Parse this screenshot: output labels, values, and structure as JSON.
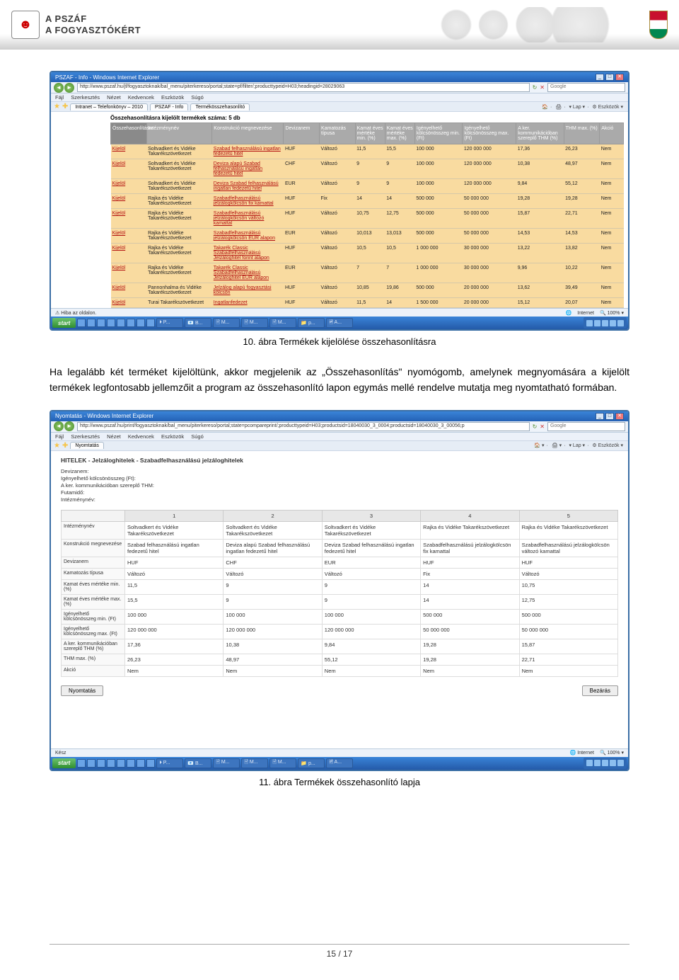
{
  "header": {
    "title1": "A PSZÁF",
    "title2": "A FOGYASZTÓKÉRT"
  },
  "fig1": {
    "window_title": "PSZAF - Info - Windows Internet Explorer",
    "url": "http://www.pszaf.hu/jf/fogyasztoknak/bal_menu/piterkereso/portal;state=pf/filter/;producttypeid=H03;headingid=28029063",
    "search_placeholder": "Google",
    "menu": [
      "Fájl",
      "Szerkesztés",
      "Nézet",
      "Kedvencek",
      "Eszközök",
      "Súgó"
    ],
    "tabs": [
      "Intranet – Telefonkönyv – 2010",
      "PSZAF - Info",
      "Termékösszehasonlító"
    ],
    "toolbar": [
      "🏠",
      "🖨",
      "▾ Lap ▾",
      "⚙ Eszközök ▾"
    ],
    "count_label": "Összehasonlításra kijelölt termékek száma: 5 db",
    "cols": [
      "Összehasonlításra",
      "Intézménynév",
      "Konstrukció megnevezése",
      "Devizanem",
      "Kamatozás típusa",
      "Kamat éves mértéke min. (%)",
      "Kamat éves mértéke max. (%)",
      "Igényelhető kölcsönösszeg min. (Ft)",
      "Igényelhető kölcsönösszeg max. (Ft)",
      "A ker. kommunikációban szereplő THM (%)",
      "THM max. (%)",
      "Akció"
    ],
    "kijelol": "Kijelöl",
    "rows": [
      {
        "inst": "Soltvadkert és Vidéke Takarékszövetkezet",
        "prod": "Szabad felhasználású ingatlan fedezetű hitel",
        "dev": "HUF",
        "kt": "Változó",
        "kmin": "11,5",
        "kmax": "15,5",
        "imin": "100 000",
        "imax": "120 000 000",
        "thm": "17,36",
        "thmmax": "26,23",
        "ak": "Nem"
      },
      {
        "inst": "Soltvadkert és Vidéke Takarékszövetkezet",
        "prod": "Deviza alapú Szabad felhasználású ingatlan fedezetű hitel",
        "dev": "CHF",
        "kt": "Változó",
        "kmin": "9",
        "kmax": "9",
        "imin": "100 000",
        "imax": "120 000 000",
        "thm": "10,38",
        "thmmax": "48,97",
        "ak": "Nem"
      },
      {
        "inst": "Soltvadkert és Vidéke Takarékszövetkezet",
        "prod": "Deviza Szabad felhasználású ingatlan fedezetű hitel",
        "dev": "EUR",
        "kt": "Változó",
        "kmin": "9",
        "kmax": "9",
        "imin": "100 000",
        "imax": "120 000 000",
        "thm": "9,84",
        "thmmax": "55,12",
        "ak": "Nem"
      },
      {
        "inst": "Rajka és Vidéke Takarékszövetkezet",
        "prod": "Szabadfelhasználású jelzálogkölcsön fix kamattal",
        "dev": "HUF",
        "kt": "Fix",
        "kmin": "14",
        "kmax": "14",
        "imin": "500 000",
        "imax": "50 000 000",
        "thm": "19,28",
        "thmmax": "19,28",
        "ak": "Nem"
      },
      {
        "inst": "Rajka és Vidéke Takarékszövetkezet",
        "prod": "Szabadfelhasználású jelzálogkölcsön változó kamattal",
        "dev": "HUF",
        "kt": "Változó",
        "kmin": "10,75",
        "kmax": "12,75",
        "imin": "500 000",
        "imax": "50 000 000",
        "thm": "15,87",
        "thmmax": "22,71",
        "ak": "Nem"
      },
      {
        "inst": "Rajka és Vidéke Takarékszövetkezet",
        "prod": "Szabadfelhasználású jelzálogkölcsön EUR alapon",
        "dev": "EUR",
        "kt": "Változó",
        "kmin": "10,013",
        "kmax": "13,013",
        "imin": "500 000",
        "imax": "50 000 000",
        "thm": "14,53",
        "thmmax": "14,53",
        "ak": "Nem"
      },
      {
        "inst": "Rajka és Vidéke Takarékszövetkezet",
        "prod": "Takarék Classic Szabadfelhasználású Jelzáloghitel forint alapon",
        "dev": "HUF",
        "kt": "Változó",
        "kmin": "10,5",
        "kmax": "10,5",
        "imin": "1 000 000",
        "imax": "30 000 000",
        "thm": "13,22",
        "thmmax": "13,82",
        "ak": "Nem"
      },
      {
        "inst": "Rajka és Vidéke Takarékszövetkezet",
        "prod": "Takarék Classic Szabadfelhasználású Jelzáloghitel EUR alapon",
        "dev": "EUR",
        "kt": "Változó",
        "kmin": "7",
        "kmax": "7",
        "imin": "1 000 000",
        "imax": "30 000 000",
        "thm": "9,96",
        "thmmax": "10,22",
        "ak": "Nem"
      },
      {
        "inst": "Pannonhalma és Vidéke Takarékszövetkezet",
        "prod": "Jelzálog alapú fogyasztási kölcsön",
        "dev": "HUF",
        "kt": "Változó",
        "kmin": "10,85",
        "kmax": "19,86",
        "imin": "500 000",
        "imax": "20 000 000",
        "thm": "13,62",
        "thmmax": "39,49",
        "ak": "Nem"
      },
      {
        "inst": "Turai Takarékszövetkezet",
        "prod": "Ingatlanfedezet",
        "dev": "HUF",
        "kt": "Változó",
        "kmin": "11,5",
        "kmax": "14",
        "imin": "1 500 000",
        "imax": "20 000 000",
        "thm": "15,12",
        "thmmax": "20,07",
        "ak": "Nem"
      }
    ],
    "status_left": "Hiba az oldalon.",
    "status_internet": "Internet",
    "status_zoom": "🔍 100% ▾",
    "taskbar_start": "start",
    "taskbar_items": [
      "⏵ P...",
      "📧 B...",
      "🖹 M...",
      "🖹 M...",
      "🖹 M...",
      "📁 p...",
      "🖻 A..."
    ],
    "caption": "10. ábra Termékek kijelölése összehasonlításra"
  },
  "paragraph": "Ha legalább két terméket kijelöltünk, akkor megjelenik az „Összehasonlítás\" nyomógomb, amelynek megnyomására a kijelölt termékek legfontosabb jellemzőit a program az összehasonlító lapon egymás mellé rendelve mutatja meg nyomtatható formában.",
  "fig2": {
    "window_title": "Nyomtatás - Windows Internet Explorer",
    "url": "http://www.pszaf.hu/print/fogyasztoknak/bal_menu/piterkereso/portal;state=pcompareprint/;producttypeid=H03;productsid=18040030_3_0004;productsid=18040030_3_00056;p",
    "search_placeholder": "Google",
    "menu": [
      "Fájl",
      "Szerkesztés",
      "Nézet",
      "Kedvencek",
      "Eszközök",
      "Súgó"
    ],
    "tab": "Nyomtatás",
    "toolbar": [
      "🏠 ▾",
      "🖨 ▾",
      "▾ Lap ▾",
      "⚙ Eszközök ▾"
    ],
    "heading": "HITELEK - Jelzáloghitelek - Szabadfelhasználású jelzáloghitelek",
    "meta": [
      "Devizanem:",
      "Igényelhető kölcsönösszeg (Ft):",
      "A ker. kommunikációban szereplő THM:",
      "Futamidő:",
      "Intézménynév:"
    ],
    "colnums": [
      "1",
      "2",
      "3",
      "4",
      "5"
    ],
    "rowheads": [
      "Intézménynév",
      "Konstrukció megnevezése",
      "Devizanem",
      "Kamatozás típusa",
      "Kamat éves mértéke min. (%)",
      "Kamat éves mértéke max. (%)",
      "Igényelhető kölcsönösszeg min. (Ft)",
      "Igényelhető kölcsönösszeg max. (Ft)",
      "A ker. kommunikációban szereplő THM (%)",
      "THM max. (%)",
      "Akció"
    ],
    "cells": [
      [
        "Soltvadkert és Vidéke Takarékszövetkezet",
        "Soltvadkert és Vidéke Takarékszövetkezet",
        "Soltvadkert és Vidéke Takarékszövetkezet",
        "Rajka és Vidéke Takarékszövetkezet",
        "Rajka és Vidéke Takarékszövetkezet"
      ],
      [
        "Szabad felhasználású ingatlan fedezetű hitel",
        "Deviza alapú Szabad felhasználású ingatlan fedezetű hitel",
        "Deviza Szabad felhasználású ingatlan fedezetű hitel",
        "Szabadfelhasználású jelzálogkölcsön fix kamattal",
        "Szabadfelhasználású jelzálogkölcsön változó kamattal"
      ],
      [
        "HUF",
        "CHF",
        "EUR",
        "HUF",
        "HUF"
      ],
      [
        "Változó",
        "Változó",
        "Változó",
        "Fix",
        "Változó"
      ],
      [
        "11,5",
        "9",
        "9",
        "14",
        "10,75"
      ],
      [
        "15,5",
        "9",
        "9",
        "14",
        "12,75"
      ],
      [
        "100 000",
        "100 000",
        "100 000",
        "500 000",
        "500 000"
      ],
      [
        "120 000 000",
        "120 000 000",
        "120 000 000",
        "50 000 000",
        "50 000 000"
      ],
      [
        "17,36",
        "10,38",
        "9,84",
        "19,28",
        "15,87"
      ],
      [
        "26,23",
        "48,97",
        "55,12",
        "19,28",
        "22,71"
      ],
      [
        "Nem",
        "Nem",
        "Nem",
        "Nem",
        "Nem"
      ]
    ],
    "print_btn": "Nyomtatás",
    "close_btn": "Bezárás",
    "status_left": "Kész",
    "status_internet": "Internet",
    "status_zoom": "🔍 100% ▾",
    "taskbar_start": "start",
    "taskbar_items": [
      "⏵ P...",
      "📧 B...",
      "🖹 M...",
      "🖹 M...",
      "🖹 M...",
      "📁 p...",
      "🖻 A..."
    ],
    "caption": "11. ábra Termékek összehasonlító lapja"
  },
  "footer": "15 / 17"
}
